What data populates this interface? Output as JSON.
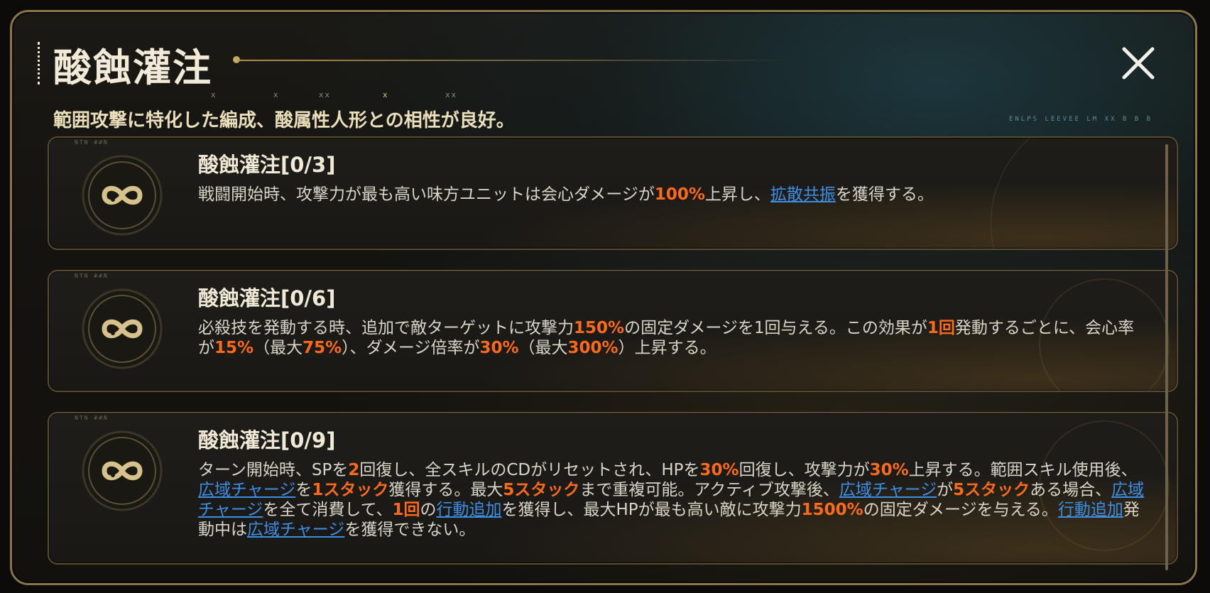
{
  "header": {
    "title": "酸蝕灌注",
    "subtitle": "範囲攻撃に特化した編成、酸属性人形との相性が良好。",
    "hud_text": "ENLPS LEEVEE LM XX B B B",
    "tick_marks": [
      "x",
      "x",
      "xx",
      "x",
      "xx"
    ]
  },
  "close_button": {
    "icon": "close-icon"
  },
  "colors": {
    "highlight": "#ff6a1a",
    "keyword_link": "#3d8fe6",
    "gold_border": "#8a7548",
    "title_text": "#f0e9d6"
  },
  "cards": [
    {
      "tag": "NTN ##N",
      "icon": "infinity-icon",
      "title": "酸蝕灌注[0/3]",
      "desc": [
        {
          "t": "戦闘開始時、攻撃力が最も高い味方ユニットは会心ダメージが"
        },
        {
          "t": "100%",
          "s": "hl"
        },
        {
          "t": "上昇し、"
        },
        {
          "t": "拡散共振",
          "s": "kw"
        },
        {
          "t": "を獲得する。"
        }
      ]
    },
    {
      "tag": "NTN ##N",
      "icon": "infinity-icon",
      "title": "酸蝕灌注[0/6]",
      "desc": [
        {
          "t": "必殺技を発動する時、追加で敵ターゲットに攻撃力"
        },
        {
          "t": "150%",
          "s": "hl"
        },
        {
          "t": "の固定ダメージを1回与える。この効果が"
        },
        {
          "t": "1回",
          "s": "hl"
        },
        {
          "t": "発動するごとに、会心率が"
        },
        {
          "t": "15%",
          "s": "hl"
        },
        {
          "t": "（最大"
        },
        {
          "t": "75%",
          "s": "hl"
        },
        {
          "t": "）、ダメージ倍率が"
        },
        {
          "t": "30%",
          "s": "hl"
        },
        {
          "t": "（最大"
        },
        {
          "t": "300%",
          "s": "hl"
        },
        {
          "t": "）上昇する。"
        }
      ]
    },
    {
      "tag": "NTN ##N",
      "icon": "infinity-icon",
      "title": "酸蝕灌注[0/9]",
      "desc": [
        {
          "t": "ターン開始時、SPを"
        },
        {
          "t": "2",
          "s": "hl"
        },
        {
          "t": "回復し、全スキルのCDがリセットされ、HPを"
        },
        {
          "t": "30%",
          "s": "hl"
        },
        {
          "t": "回復し、攻撃力が"
        },
        {
          "t": "30%",
          "s": "hl"
        },
        {
          "t": "上昇する。範囲スキル使用後、"
        },
        {
          "t": "広域チャージ",
          "s": "kw"
        },
        {
          "t": "を"
        },
        {
          "t": "1スタック",
          "s": "hl"
        },
        {
          "t": "獲得する。最大"
        },
        {
          "t": "5スタック",
          "s": "hl"
        },
        {
          "t": "まで重複可能。アクティブ攻撃後、"
        },
        {
          "t": "広域チャージ",
          "s": "kw"
        },
        {
          "t": "が"
        },
        {
          "t": "5スタック",
          "s": "hl"
        },
        {
          "t": "ある場合、"
        },
        {
          "t": "広域チャージ",
          "s": "kw"
        },
        {
          "t": "を全て消費して、"
        },
        {
          "t": "1回",
          "s": "hl"
        },
        {
          "t": "の"
        },
        {
          "t": "行動追加",
          "s": "kw"
        },
        {
          "t": "を獲得し、最大HPが最も高い敵に攻撃力"
        },
        {
          "t": "1500%",
          "s": "hl"
        },
        {
          "t": "の固定ダメージを与える。"
        },
        {
          "t": "行動追加",
          "s": "kw"
        },
        {
          "t": "発動中は"
        },
        {
          "t": "広域チャージ",
          "s": "kw"
        },
        {
          "t": "を獲得できない。"
        }
      ]
    }
  ]
}
